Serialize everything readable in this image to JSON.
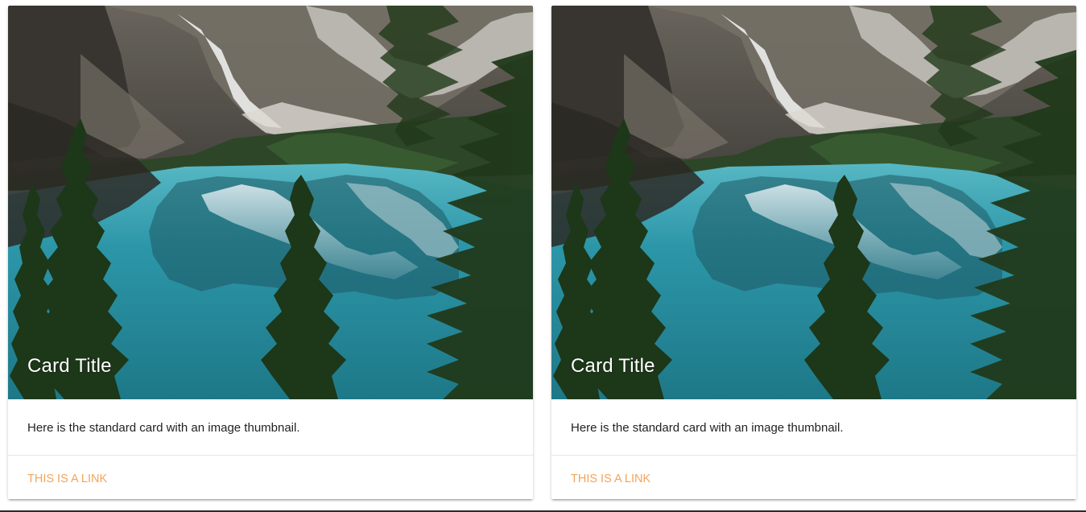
{
  "cards": [
    {
      "image_alt": "Mountain lake with evergreen trees",
      "title": "Card Title",
      "content": "Here is the standard card with an image thumbnail.",
      "link": "This is a link"
    },
    {
      "image_alt": "Mountain lake with evergreen trees",
      "title": "Card Title",
      "content": "Here is the standard card with an image thumbnail.",
      "link": "This is a link"
    }
  ],
  "colors": {
    "link": "#f4a35a",
    "lake": "#2fa2b6",
    "forest": "#1f3a1b"
  }
}
